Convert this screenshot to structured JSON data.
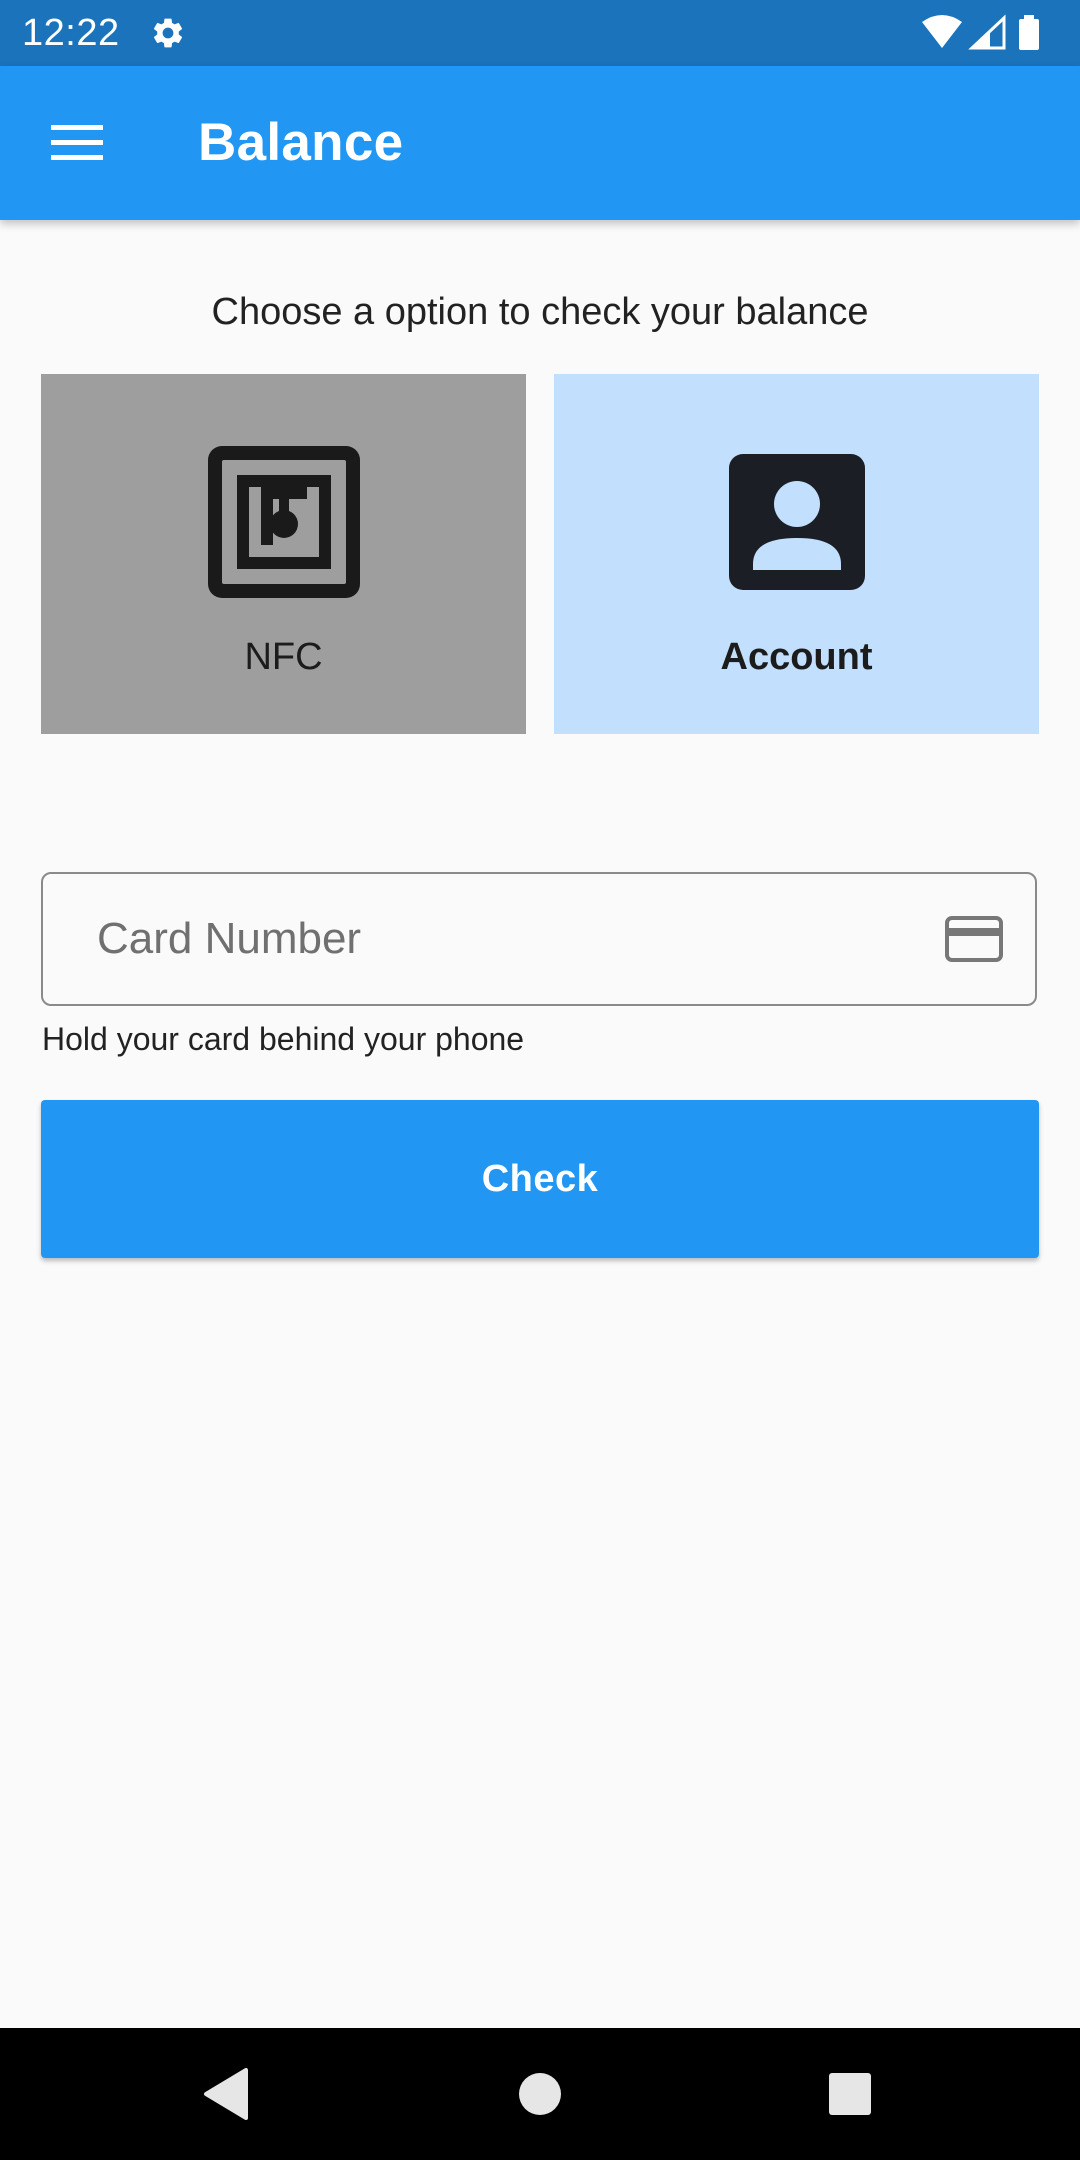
{
  "status_bar": {
    "time": "12:22",
    "settings_icon": "gear-icon",
    "wifi_icon": "wifi-icon",
    "signal_icon": "cell-signal-icon",
    "battery_icon": "battery-icon"
  },
  "app_bar": {
    "menu_icon": "hamburger-menu-icon",
    "title": "Balance",
    "color": "#2196f3"
  },
  "main": {
    "prompt": "Choose a option to check your balance",
    "options": [
      {
        "label": "NFC",
        "icon": "nfc-icon",
        "background": "#9e9e9e",
        "selected": true
      },
      {
        "label": "Account",
        "icon": "account-box-icon",
        "background": "#c2e0fd",
        "selected": false
      }
    ],
    "card_input": {
      "placeholder": "Card Number",
      "value": "",
      "icon": "credit-card-icon"
    },
    "helper_text": "Hold your card behind your phone",
    "check_button": {
      "label": "Check",
      "color": "#2196f3"
    }
  },
  "nav_bar": {
    "back_icon": "back-triangle-icon",
    "home_icon": "home-circle-icon",
    "recents_icon": "recents-square-icon"
  }
}
